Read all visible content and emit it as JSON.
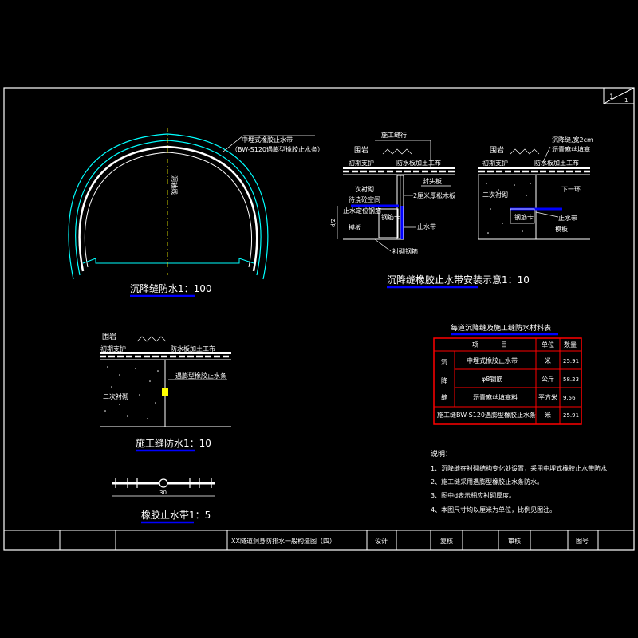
{
  "sheet": {
    "number_top": "1",
    "number_bottom": "1"
  },
  "tunnel": {
    "callout_line1": "中埋式橡胶止水带",
    "callout_line2": "（BW-S120遇膨型橡胶止水条）",
    "axis_label": "洞轴线",
    "title": "沉降缝防水1：100"
  },
  "install_diagram": {
    "title": "沉降缝橡胶止水带安装示意1：10",
    "left": {
      "top_label": "施工缝行",
      "surround_rock": "围岩",
      "primary_support": "初期支护",
      "waterproof_board": "防水板加土工布",
      "seal_strip": "封头板",
      "secondary_lining": "二次衬砌",
      "pos_label_1": "待浇砼空间",
      "pos_label_2": "止水定位钢筋",
      "board_label": "2厘米厚松木板",
      "clamp_label": "钢筋卡",
      "waterstop_label": "止水带",
      "formwork_label": "模板",
      "rebar_label": "衬砌钢筋",
      "dim_label": "d/2"
    },
    "right": {
      "gap_label_1": "沉降缝,宽2cm",
      "gap_label_2": "沥青麻丝填塞",
      "surround_rock": "围岩",
      "primary_support": "初期支护",
      "waterproof_board": "防水板加土工布",
      "secondary_lining": "二次衬砌",
      "next_ring": "下一环",
      "clamp_label": "钢筋卡",
      "waterstop_label": "止水带",
      "formwork_label": "模板"
    }
  },
  "construction_joint": {
    "surround_rock": "围岩",
    "primary_support": "初期支护",
    "waterproof_board": "防水板加土工布",
    "swell_strip": "遇膨型橡胶止水条",
    "secondary_lining": "二次衬砌",
    "title": "施工缝防水1：10"
  },
  "rubber_waterstop": {
    "dimension": "30",
    "title": "橡胶止水带1：5"
  },
  "materials_table": {
    "title": "每道沉降缝及施工缝防水材料表",
    "headers": [
      "项",
      "目",
      "单位",
      "数量"
    ],
    "group_label": [
      "沉",
      "降",
      "缝"
    ],
    "rows": [
      {
        "item": "中埋式橡胶止水带",
        "unit": "米",
        "qty": "25.91"
      },
      {
        "item": "φ8钢筋",
        "unit": "公斤",
        "qty": "58.23"
      },
      {
        "item": "沥青麻丝填塞料",
        "unit": "平方米",
        "qty": "9.56"
      }
    ],
    "last_row": {
      "item": "施工缝BW-S120遇膨型橡胶止水条",
      "unit": "米",
      "qty": "25.91"
    }
  },
  "notes": {
    "heading": "说明：",
    "items": [
      "1、沉降缝在衬砌结构变化处设置，采用中埋式橡胶止水带防水",
      "2、施工缝采用遇膨型橡胶止水条防水。",
      "3、图中d表示相应衬砌厚度。",
      "4、本图尺寸均以厘米为单位，比例见图注。"
    ]
  },
  "title_block": {
    "drawing_title": "XX隧道洞身防排水一般构造图（四）",
    "design": "设计",
    "review": "复核",
    "approve": "审核",
    "drawing_no": "图号"
  },
  "colors": {
    "background": "#000000",
    "line": "#ffffff",
    "cyan": "#00ffff",
    "blue": "#0000ff",
    "yellow": "#ffff00"
  }
}
